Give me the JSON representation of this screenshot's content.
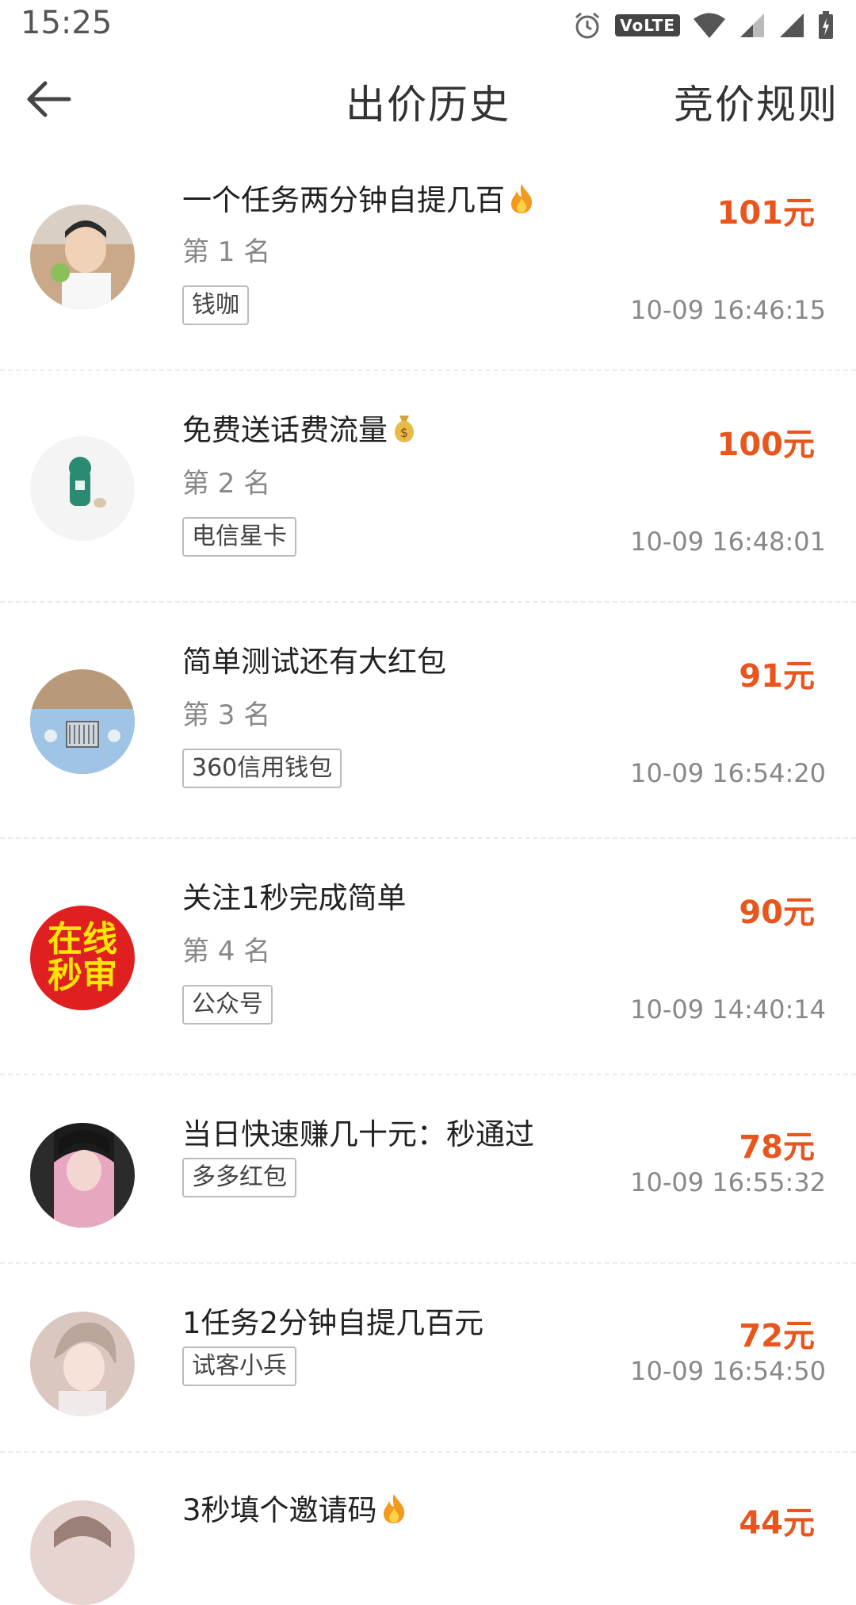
{
  "status": {
    "time": "15:25",
    "volte": "VoLTE"
  },
  "header": {
    "title": "出价历史",
    "rules_label": "竞价规则"
  },
  "bids": [
    {
      "title": "一个任务两分钟自提几百",
      "title_icon": "fire-icon",
      "rank": "第 1 名",
      "tag": "钱咖",
      "price": "101元",
      "time": "10-09 16:46:15",
      "avatar_color": "#c9a98a"
    },
    {
      "title": "免费送话费流量",
      "title_icon": "money-bag-icon",
      "rank": "第 2 名",
      "tag": "电信星卡",
      "price": "100元",
      "time": "10-09 16:48:01",
      "avatar_color": "#f4f4f4"
    },
    {
      "title": "简单测试还有大红包",
      "title_icon": "",
      "rank": "第 3 名",
      "tag": "360信用钱包",
      "price": "91元",
      "time": "10-09 16:54:20",
      "avatar_color": "#9fc4e6"
    },
    {
      "title": "关注1秒完成简单",
      "title_icon": "",
      "rank": "第 4 名",
      "tag": "公众号",
      "price": "90元",
      "time": "10-09 14:40:14",
      "avatar_color": "#e02020",
      "avatar_text": "在线秒审"
    },
    {
      "title": "当日快速赚几十元：秒通过",
      "title_icon": "",
      "rank": "",
      "tag": "多多红包",
      "price": "78元",
      "time": "10-09 16:55:32",
      "avatar_color": "#2b2b2b"
    },
    {
      "title": "1任务2分钟自提几百元",
      "title_icon": "",
      "rank": "",
      "tag": "试客小兵",
      "price": "72元",
      "time": "10-09 16:54:50",
      "avatar_color": "#d9c7c0"
    },
    {
      "title": "3秒填个邀请码",
      "title_icon": "fire-icon",
      "rank": "",
      "tag": "",
      "price": "44元",
      "time": "",
      "avatar_color": "#e6d4d0"
    }
  ]
}
